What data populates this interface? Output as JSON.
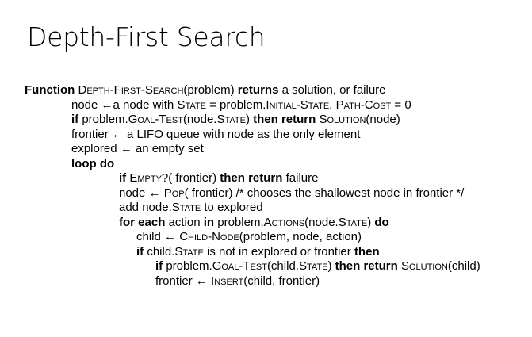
{
  "slide": {
    "title": "Depth-First Search"
  },
  "algorithm": {
    "lines": [
      {
        "indent": 31,
        "parts": [
          [
            "kw",
            "Function "
          ],
          [
            "sc",
            "Depth-First-Search"
          ],
          [
            "t",
            "(problem) "
          ],
          [
            "kw",
            "returns"
          ],
          [
            "t",
            " a solution, or failure"
          ]
        ]
      },
      {
        "indent": 90,
        "parts": [
          [
            "t",
            "node ←a node with "
          ],
          [
            "sc",
            "State"
          ],
          [
            "t",
            " = problem."
          ],
          [
            "sc",
            "Initial-State"
          ],
          [
            "t",
            ", "
          ],
          [
            "sc",
            "Path-Cost"
          ],
          [
            "t",
            " = 0"
          ]
        ]
      },
      {
        "indent": 90,
        "parts": [
          [
            "kw",
            "if"
          ],
          [
            "t",
            " problem."
          ],
          [
            "sc",
            "Goal-Test"
          ],
          [
            "t",
            "(node."
          ],
          [
            "sc",
            "State"
          ],
          [
            "t",
            ") "
          ],
          [
            "kw",
            "then return"
          ],
          [
            "t",
            " "
          ],
          [
            "sc",
            "Solution"
          ],
          [
            "t",
            "(node)"
          ]
        ]
      },
      {
        "indent": 90,
        "parts": [
          [
            "t",
            "frontier ← a LIFO queue with node as the only element"
          ]
        ]
      },
      {
        "indent": 90,
        "parts": [
          [
            "t",
            "explored ← an empty set"
          ]
        ]
      },
      {
        "indent": 90,
        "parts": [
          [
            "kw",
            "loop do"
          ]
        ]
      },
      {
        "indent": 150,
        "parts": [
          [
            "kw",
            "if"
          ],
          [
            "t",
            " "
          ],
          [
            "sc",
            "Empty"
          ],
          [
            "t",
            "?( frontier) "
          ],
          [
            "kw",
            "then return"
          ],
          [
            "t",
            " failure"
          ]
        ]
      },
      {
        "indent": 150,
        "parts": [
          [
            "t",
            "node ← "
          ],
          [
            "sc",
            "Pop"
          ],
          [
            "t",
            "( frontier) /* chooses the shallowest node in frontier */"
          ]
        ]
      },
      {
        "indent": 150,
        "parts": [
          [
            "t",
            "add node."
          ],
          [
            "sc",
            "State"
          ],
          [
            "t",
            " to explored"
          ]
        ]
      },
      {
        "indent": 150,
        "parts": [
          [
            "kw",
            "for each"
          ],
          [
            "t",
            " action "
          ],
          [
            "kw",
            "in"
          ],
          [
            "t",
            " problem."
          ],
          [
            "sc",
            "Actions"
          ],
          [
            "t",
            "(node."
          ],
          [
            "sc",
            "State"
          ],
          [
            "t",
            ") "
          ],
          [
            "kw",
            "do"
          ]
        ]
      },
      {
        "indent": 172,
        "parts": [
          [
            "t",
            "child ← "
          ],
          [
            "sc",
            "Child-Node"
          ],
          [
            "t",
            "(problem, node, action)"
          ]
        ]
      },
      {
        "indent": 172,
        "parts": [
          [
            "kw",
            "if"
          ],
          [
            "t",
            " child."
          ],
          [
            "sc",
            "State"
          ],
          [
            "t",
            " is not in explored or frontier "
          ],
          [
            "kw",
            "then"
          ]
        ]
      },
      {
        "indent": 196,
        "parts": [
          [
            "kw",
            "if"
          ],
          [
            "t",
            " problem."
          ],
          [
            "sc",
            "Goal-Test"
          ],
          [
            "t",
            "(child."
          ],
          [
            "sc",
            "State"
          ],
          [
            "t",
            ") "
          ],
          [
            "kw",
            "then return"
          ],
          [
            "t",
            " "
          ],
          [
            "sc",
            "Solution"
          ],
          [
            "t",
            "(child)"
          ]
        ]
      },
      {
        "indent": 196,
        "parts": [
          [
            "t",
            "frontier ← "
          ],
          [
            "sc",
            "Insert"
          ],
          [
            "t",
            "(child, frontier)"
          ]
        ]
      }
    ]
  }
}
